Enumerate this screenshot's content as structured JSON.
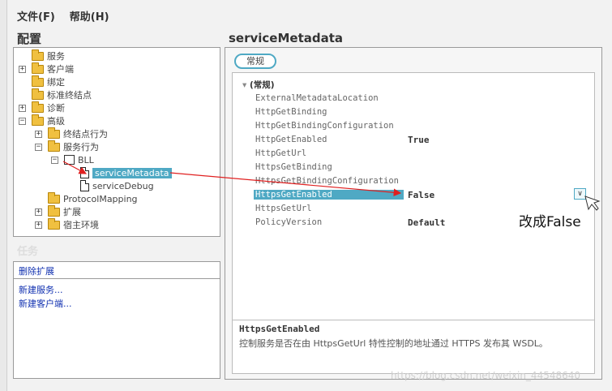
{
  "menu": {
    "file": "文件(F)",
    "help": "帮助(H)"
  },
  "config_header": "配置",
  "tree": {
    "items": [
      "服务",
      "客户端",
      "绑定",
      "标准终结点",
      "诊断",
      "高级",
      "终结点行为",
      "服务行为",
      "BLL",
      "serviceMetadata",
      "serviceDebug",
      "ProtocolMapping",
      "扩展",
      "宿主环境"
    ]
  },
  "tasks": {
    "title": "任务",
    "delete_ext": "删除扩展",
    "new_service": "新建服务...",
    "new_client": "新建客户端..."
  },
  "right_header": "serviceMetadata",
  "tab_general": "常规",
  "group_label": "(常规)",
  "properties": [
    {
      "name": "ExternalMetadataLocation",
      "value": ""
    },
    {
      "name": "HttpGetBinding",
      "value": ""
    },
    {
      "name": "HttpGetBindingConfiguration",
      "value": ""
    },
    {
      "name": "HttpGetEnabled",
      "value": "True"
    },
    {
      "name": "HttpGetUrl",
      "value": ""
    },
    {
      "name": "HttpsGetBinding",
      "value": ""
    },
    {
      "name": "HttpsGetBindingConfiguration",
      "value": ""
    },
    {
      "name": "HttpsGetEnabled",
      "value": "False"
    },
    {
      "name": "HttpsGetUrl",
      "value": ""
    },
    {
      "name": "PolicyVersion",
      "value": "Default"
    }
  ],
  "description": {
    "title": "HttpsGetEnabled",
    "text": "控制服务是否在由 HttpsGetUrl 特性控制的地址通过 HTTPS 发布其 WSDL。"
  },
  "annotation": "改成False",
  "watermark": "https://blog.csdn.net/weixin_44548640",
  "colors": {
    "selection": "#4fa9c4",
    "arrow": "#e02020"
  }
}
